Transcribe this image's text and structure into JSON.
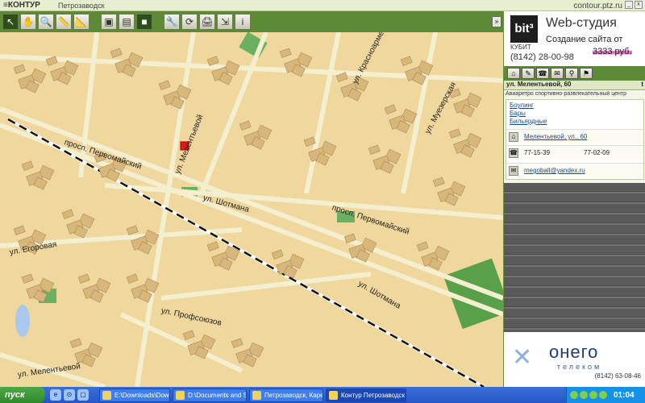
{
  "app": {
    "logo": "≡КОНТУР",
    "city": "Петрозаводск",
    "site": "contour.ptz.ru"
  },
  "window_controls": [
    "_",
    "x"
  ],
  "toolbar": {
    "buttons": [
      {
        "icon": "pointer-icon",
        "glyph": "↖",
        "active": true
      },
      {
        "icon": "hand-icon",
        "glyph": "✋"
      },
      {
        "icon": "zoom-icon",
        "glyph": "🔍"
      },
      {
        "icon": "ruler-icon",
        "glyph": "📏"
      },
      {
        "icon": "measure-icon",
        "glyph": "📐"
      },
      {
        "icon": "layer-green-icon",
        "glyph": "▣"
      },
      {
        "icon": "layer-map-icon",
        "glyph": "▤"
      },
      {
        "icon": "layer-square-icon",
        "glyph": "■",
        "active": true
      },
      {
        "icon": "tools-icon",
        "glyph": "🔧"
      },
      {
        "icon": "refresh-icon",
        "glyph": "⟳"
      },
      {
        "icon": "print-icon",
        "glyph": "🖨"
      },
      {
        "icon": "export-icon",
        "glyph": "⇲"
      },
      {
        "icon": "info-icon",
        "glyph": "i"
      }
    ],
    "expand_glyph": "»"
  },
  "map": {
    "labels": [
      {
        "text": "просп. Первомайский",
        "name": "street-pervomaisky-1"
      },
      {
        "text": "ул. Мелентьевой",
        "name": "street-melentyevoy"
      },
      {
        "text": "ул. Шотмана",
        "name": "street-shotmana-1"
      },
      {
        "text": "просп. Первомайский",
        "name": "street-pervomaisky-2"
      },
      {
        "text": "ул. Егоровая",
        "name": "street-egorovaya"
      },
      {
        "text": "ул. Профсоюзов",
        "name": "street-profsoyuzov"
      },
      {
        "text": "ул. Шотмана",
        "name": "street-shotmana-2"
      },
      {
        "text": "ул. Красноармейская",
        "name": "street-krasnoarmeyskaya"
      },
      {
        "text": "ул. Муезерская",
        "name": "street-muezerskaya"
      },
      {
        "text": "ул. Мелентьевой",
        "name": "street-melentyevoy-2"
      }
    ]
  },
  "ad": {
    "logo": "bit³",
    "logo_sub": "КУБИТ",
    "title": "Web-студия",
    "line": "Создание сайта от",
    "price": "3333 руб.",
    "phone": "(8142) 28-00-98"
  },
  "panel": {
    "tool_glyphs": [
      "⌂",
      "✎",
      "☎",
      "✉",
      "⚲",
      "⚑"
    ],
    "title": "ул. Мелентьевой, 60",
    "close": "t",
    "categories": "Авиаретро     спортивно-развлекательный центр",
    "links": [
      "Боулинг",
      "Бары",
      "Бильярдные"
    ],
    "address": "Мелентьевой, ул., 60",
    "phones": [
      "77-15-39",
      "77-02-09"
    ],
    "email": "megoball@yandex.ru"
  },
  "bottom_ad": {
    "name": "онего",
    "sub": "телеком",
    "phone": "(8142) 63-08-46"
  },
  "taskbar": {
    "start": "пуск",
    "quick": [
      "e",
      "⊙",
      "▢"
    ],
    "tasks": [
      {
        "label": "E:\\Downloads\\Downl...",
        "width": 88
      },
      {
        "label": "D:\\Documents and Se...",
        "width": 92
      },
      {
        "label": "Петрозаводск, Каре...",
        "width": 92
      },
      {
        "label": "Контур Петрозаводск",
        "width": 100,
        "active": true
      }
    ],
    "clock": "01:04"
  }
}
